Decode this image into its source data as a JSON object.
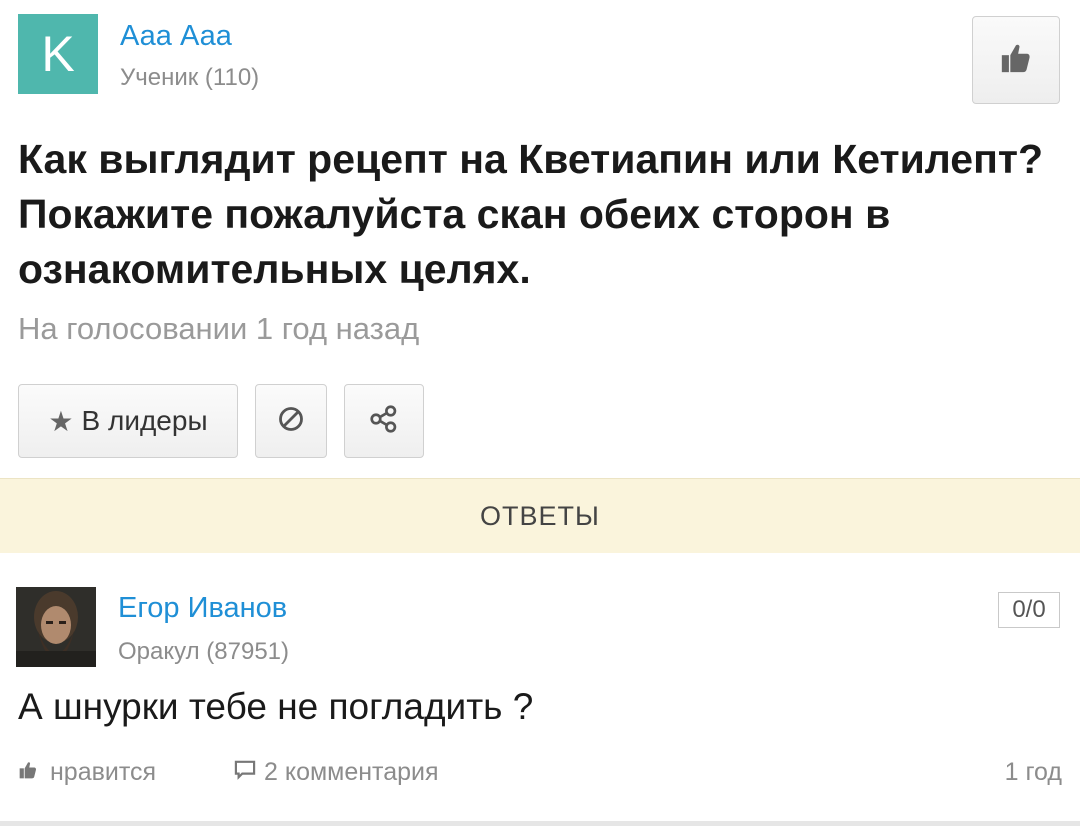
{
  "question": {
    "author_initial": "K",
    "author_name": "Ааа Ааа",
    "author_rank": "Ученик (110)",
    "title": "Как выглядит рецепт на Кветиапин или Кетилепт? Покажите пожалуйста скан обеих сторон в ознакомительных целях.",
    "status": "На голосовании 1 год назад",
    "avatar_color": "#4fb7ad"
  },
  "actions": {
    "leaders_label": "В лидеры",
    "icons": [
      "star-icon",
      "block-icon",
      "share-icon",
      "thumbs-up-icon"
    ]
  },
  "answers_bar": {
    "label": "ОТВЕТЫ",
    "background": "#faf4dc"
  },
  "answer": {
    "author_name": "Егор Иванов",
    "author_rank": "Оракул (87951)",
    "score": "0/0",
    "text": "А шнурки тебе не погладить ?",
    "like_label": "нравится",
    "comments_label": "2 комментария",
    "time": "1 год"
  },
  "colors": {
    "link": "#1f8fd6",
    "muted": "#8c8c8c"
  }
}
